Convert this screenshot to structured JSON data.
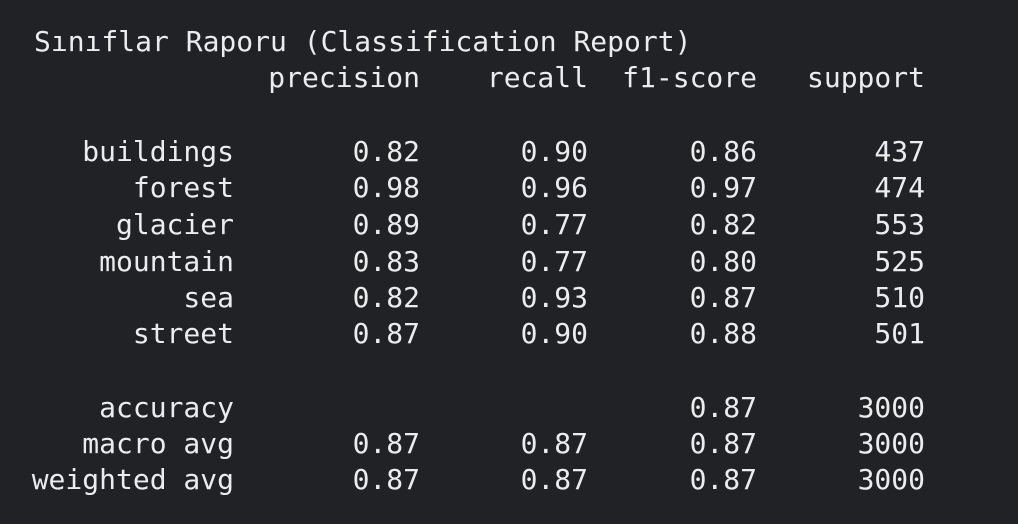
{
  "report": {
    "title": "Sınıflar Raporu (Classification Report)",
    "headers": {
      "precision": "precision",
      "recall": "recall",
      "f1": "f1-score",
      "support": "support"
    },
    "rows": [
      {
        "label": "buildings",
        "precision": "0.82",
        "recall": "0.90",
        "f1": "0.86",
        "support": "437"
      },
      {
        "label": "forest",
        "precision": "0.98",
        "recall": "0.96",
        "f1": "0.97",
        "support": "474"
      },
      {
        "label": "glacier",
        "precision": "0.89",
        "recall": "0.77",
        "f1": "0.82",
        "support": "553"
      },
      {
        "label": "mountain",
        "precision": "0.83",
        "recall": "0.77",
        "f1": "0.80",
        "support": "525"
      },
      {
        "label": "sea",
        "precision": "0.82",
        "recall": "0.93",
        "f1": "0.87",
        "support": "510"
      },
      {
        "label": "street",
        "precision": "0.87",
        "recall": "0.90",
        "f1": "0.88",
        "support": "501"
      }
    ],
    "summary": [
      {
        "label": "accuracy",
        "precision": "",
        "recall": "",
        "f1": "0.87",
        "support": "3000"
      },
      {
        "label": "macro avg",
        "precision": "0.87",
        "recall": "0.87",
        "f1": "0.87",
        "support": "3000"
      },
      {
        "label": "weighted avg",
        "precision": "0.87",
        "recall": "0.87",
        "f1": "0.87",
        "support": "3000"
      }
    ],
    "colors": {
      "background": "#212226",
      "text": "#ececec"
    }
  }
}
